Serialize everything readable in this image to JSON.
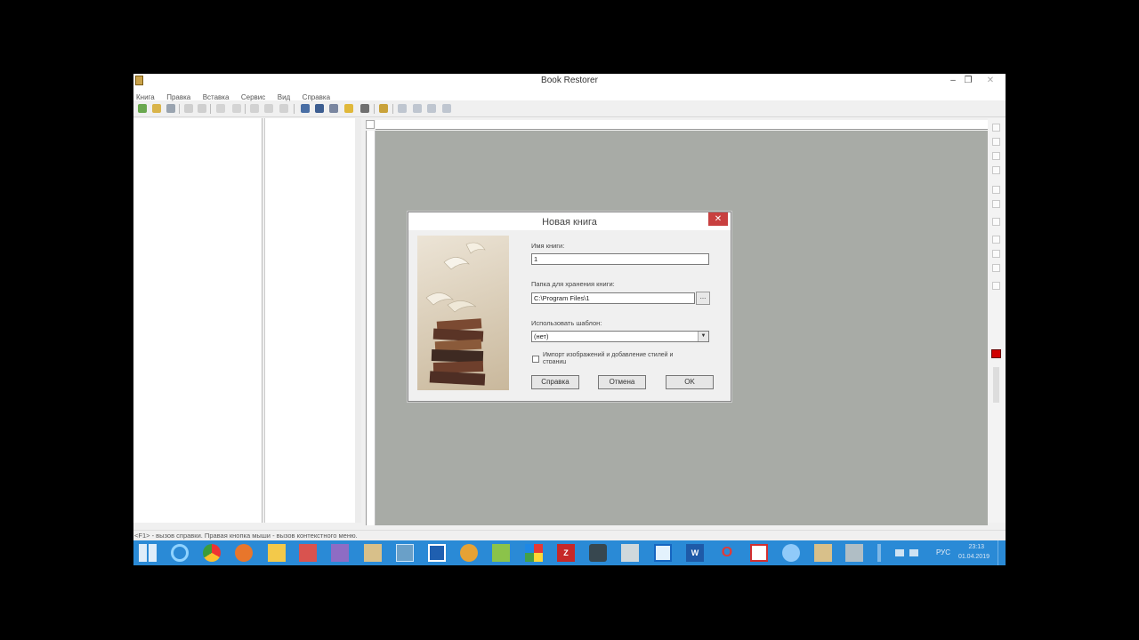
{
  "window": {
    "title": "Book Restorer",
    "min_glyph": "–",
    "restore_glyph": "❐",
    "close_glyph": "✕"
  },
  "menu": [
    "Книга",
    "Правка",
    "Вставка",
    "Сервис",
    "Вид",
    "Справка"
  ],
  "status_bar": {
    "text": "<F1> - вызов справки. Правая кнопка мыши - вызов контекстного меню."
  },
  "dialog": {
    "title": "Новая книга",
    "close_glyph": "✕",
    "book_name_label": "Имя книги:",
    "book_name_value": "1",
    "folder_label": "Папка для хранения книги:",
    "folder_value": "C:\\Program Files\\1",
    "browse_label": "...",
    "template_label": "Использовать шаблон:",
    "template_value": "(нет)",
    "template_arrow": "▼",
    "import_checkbox_label": "Импорт изображений и добавление стилей и",
    "import_checkbox_label_cont": "страниц",
    "import_checked": false,
    "help_button": "Справка",
    "cancel_button": "Отмена",
    "ok_button": "OK"
  },
  "taskbar": {
    "lang": "РУС",
    "time": "23:13",
    "date": "01.04.2019",
    "filezilla_glyph": "Z",
    "word_glyph": "W",
    "opera_glyph": "O",
    "apps": [
      "start",
      "ie",
      "chrome",
      "firefox",
      "explorer",
      "photo-app",
      "onenote",
      "book-restorer",
      "paint",
      "save-app",
      "puzzle-app",
      "notepad-app",
      "color-app",
      "filezilla",
      "camera",
      "scanner",
      "virtualbox",
      "word",
      "opera",
      "acrobat",
      "network-app",
      "book-restorer-2",
      "remote-app"
    ]
  },
  "colors": {
    "canvas": "#a8aba6",
    "taskbar": "#2a8ad6",
    "dialog_close": "#c84040",
    "drawing_color": "#d00000"
  }
}
